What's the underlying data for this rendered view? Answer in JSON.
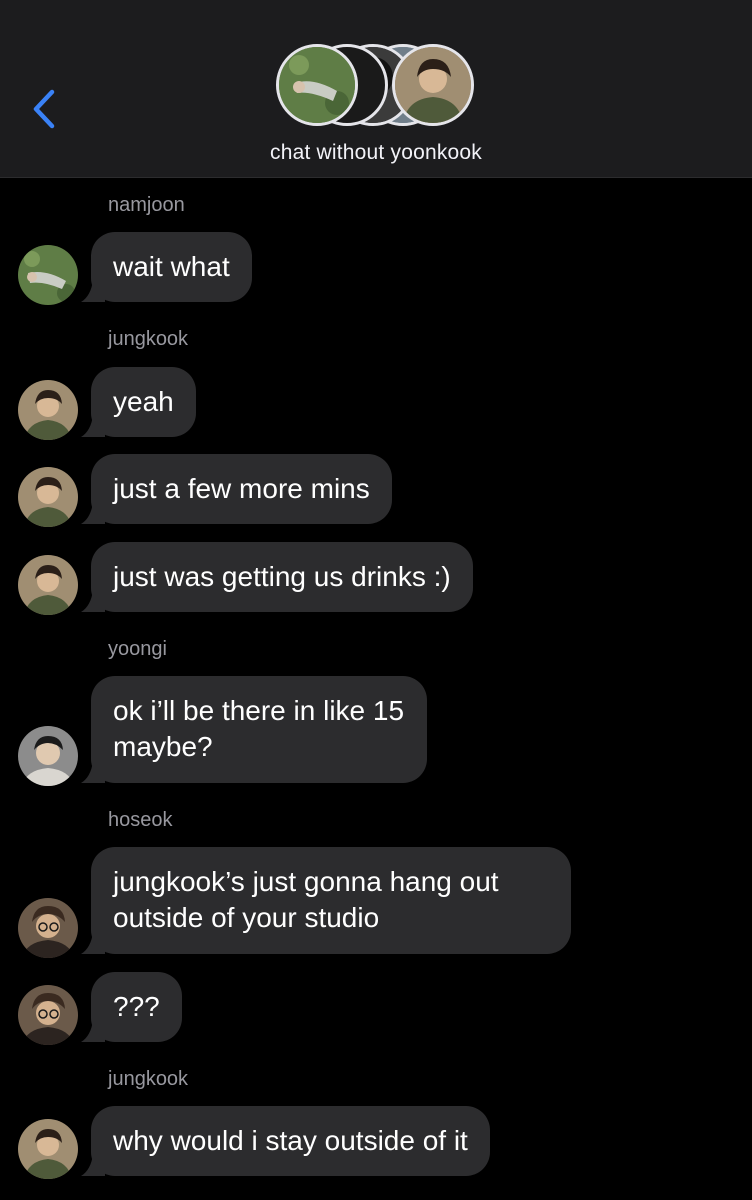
{
  "header": {
    "back_icon": "chevron-left-icon",
    "group_title": "chat without yoonkook",
    "accent": "#3a82f7"
  },
  "colors": {
    "background": "#000000",
    "header_bg": "#1c1c1e",
    "bubble": "#2c2c2e",
    "sender_text": "#98989f"
  },
  "messages": [
    {
      "sender": "namjoon",
      "avatar": "namjoon-avatar",
      "text": "wait what"
    },
    {
      "sender": "jungkook",
      "avatar": "jungkook-avatar",
      "text": "yeah"
    },
    {
      "sender": "jungkook",
      "avatar": "jungkook-avatar",
      "text": "just a few more mins"
    },
    {
      "sender": "jungkook",
      "avatar": "jungkook-avatar",
      "text": "just was getting us drinks :)"
    },
    {
      "sender": "yoongi",
      "avatar": "yoongi-avatar",
      "text": "ok i’ll be there in like 15 maybe?"
    },
    {
      "sender": "hoseok",
      "avatar": "hoseok-avatar",
      "text": "jungkook’s just gonna hang out outside of your studio"
    },
    {
      "sender": "hoseok",
      "avatar": "hoseok-avatar",
      "text": "???"
    },
    {
      "sender": "jungkook",
      "avatar": "jungkook-avatar",
      "text": "why would i stay outside of it"
    }
  ]
}
